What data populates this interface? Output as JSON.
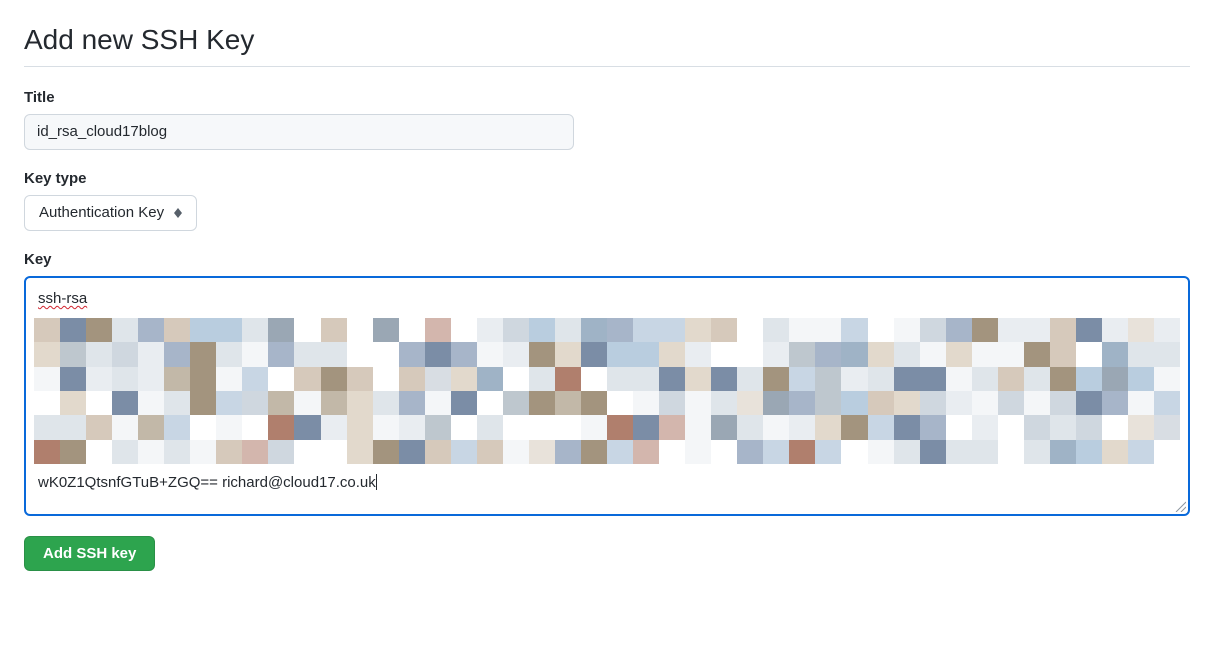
{
  "page": {
    "title": "Add new SSH Key"
  },
  "form": {
    "title_label": "Title",
    "title_value": "id_rsa_cloud17blog",
    "keytype_label": "Key type",
    "keytype_value": "Authentication Key",
    "key_label": "Key",
    "key_prefix": "ssh-rsa",
    "key_suffix": "wK0Z1QtsnfGTuB+ZGQ== richard@cloud17.co.uk",
    "submit_label": "Add SSH key"
  },
  "pixel_palette": [
    "#f4f6f8",
    "#ffffff",
    "#e9edf1",
    "#dfe5ea",
    "#c8d6e4",
    "#b9cddf",
    "#d6c9bb",
    "#e2d9cc",
    "#c2b8a8",
    "#a3947e",
    "#a7b5c9",
    "#7b8da6",
    "#b07f6d",
    "#d3b6ad",
    "#9fb3c6",
    "#cfd7df",
    "#e8e2da",
    "#bec7ce",
    "#9aa7b4",
    "#d8dde3"
  ]
}
